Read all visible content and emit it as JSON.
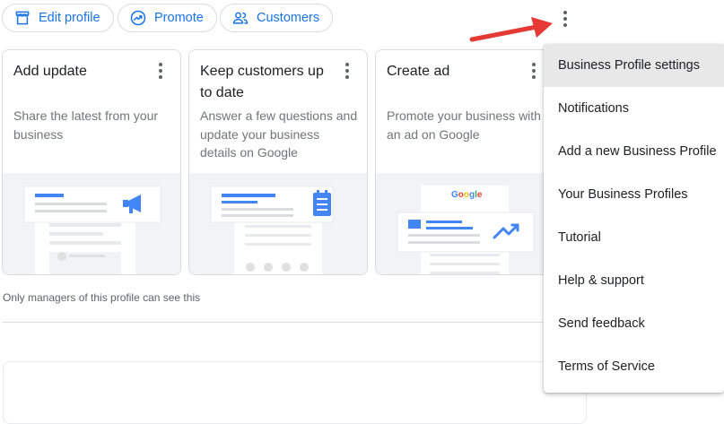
{
  "chips": [
    {
      "label": "Edit profile",
      "icon": "storefront-icon"
    },
    {
      "label": "Promote",
      "icon": "trending-up-icon"
    },
    {
      "label": "Customers",
      "icon": "people-icon"
    }
  ],
  "cards": [
    {
      "title": "Add update",
      "description": "Share the latest from your business"
    },
    {
      "title": "Keep customers up to date",
      "description": "Answer a few questions and update your business details on Google"
    },
    {
      "title": "Create ad",
      "description": "Promote your business with an ad on Google",
      "illustration_label": "Google"
    }
  ],
  "note": "Only managers of this profile can see this",
  "menu": {
    "items": [
      "Business Profile settings",
      "Notifications",
      "Add a new Business Profile",
      "Your Business Profiles",
      "Tutorial",
      "Help & support",
      "Send feedback",
      "Terms of Service"
    ],
    "highlighted_index": 0
  },
  "colors": {
    "accent": "#1a73e8",
    "arrow": "#e53935",
    "illustration_bg": "#f1f3f4"
  }
}
